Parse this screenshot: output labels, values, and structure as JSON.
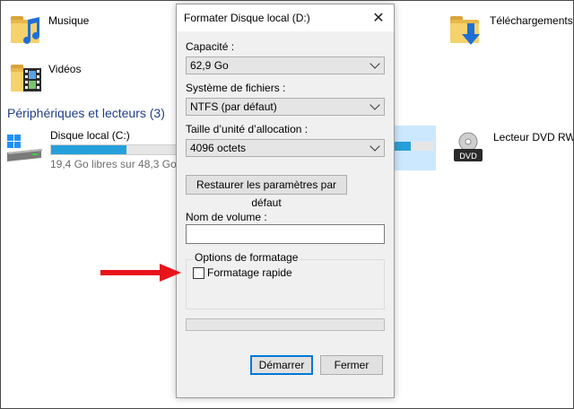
{
  "explorer": {
    "folders": [
      {
        "label": "Musique",
        "icon": "music-folder-icon"
      },
      {
        "label": "Vidéos",
        "icon": "video-folder-icon"
      },
      {
        "label": "Téléchargements",
        "icon": "downloads-folder-icon"
      }
    ],
    "section_title": "Périphériques et lecteurs (3)",
    "drives": [
      {
        "name": "Disque local (C:)",
        "subtitle": "19,4 Go libres sur 48,3 Go",
        "used_fraction": 0.6,
        "icon": "windows-drive-icon"
      },
      {
        "name": "Lecteur DVD RW (E",
        "icon": "dvd-drive-icon",
        "badge": "DVD"
      }
    ],
    "accent_color": "#26a0da",
    "section_color": "#1e3f8a"
  },
  "dialog": {
    "title": "Formater Disque local (D:)",
    "capacity_label": "Capacité :",
    "capacity_value": "62,9 Go",
    "filesystem_label": "Système de fichiers :",
    "filesystem_value": "NTFS (par défaut)",
    "allocation_label": "Taille d’unité d’allocation :",
    "allocation_value": "4096 octets",
    "restore_button": "Restaurer les paramètres par défaut",
    "volume_label": "Nom de volume :",
    "volume_value": "",
    "options_legend": "Options de formatage",
    "quick_format_label": "Formatage rapide",
    "quick_format_checked": false,
    "progress": 0,
    "start_button": "Démarrer",
    "close_button": "Fermer"
  },
  "annotation": {
    "arrow_color": "#e8141b"
  }
}
